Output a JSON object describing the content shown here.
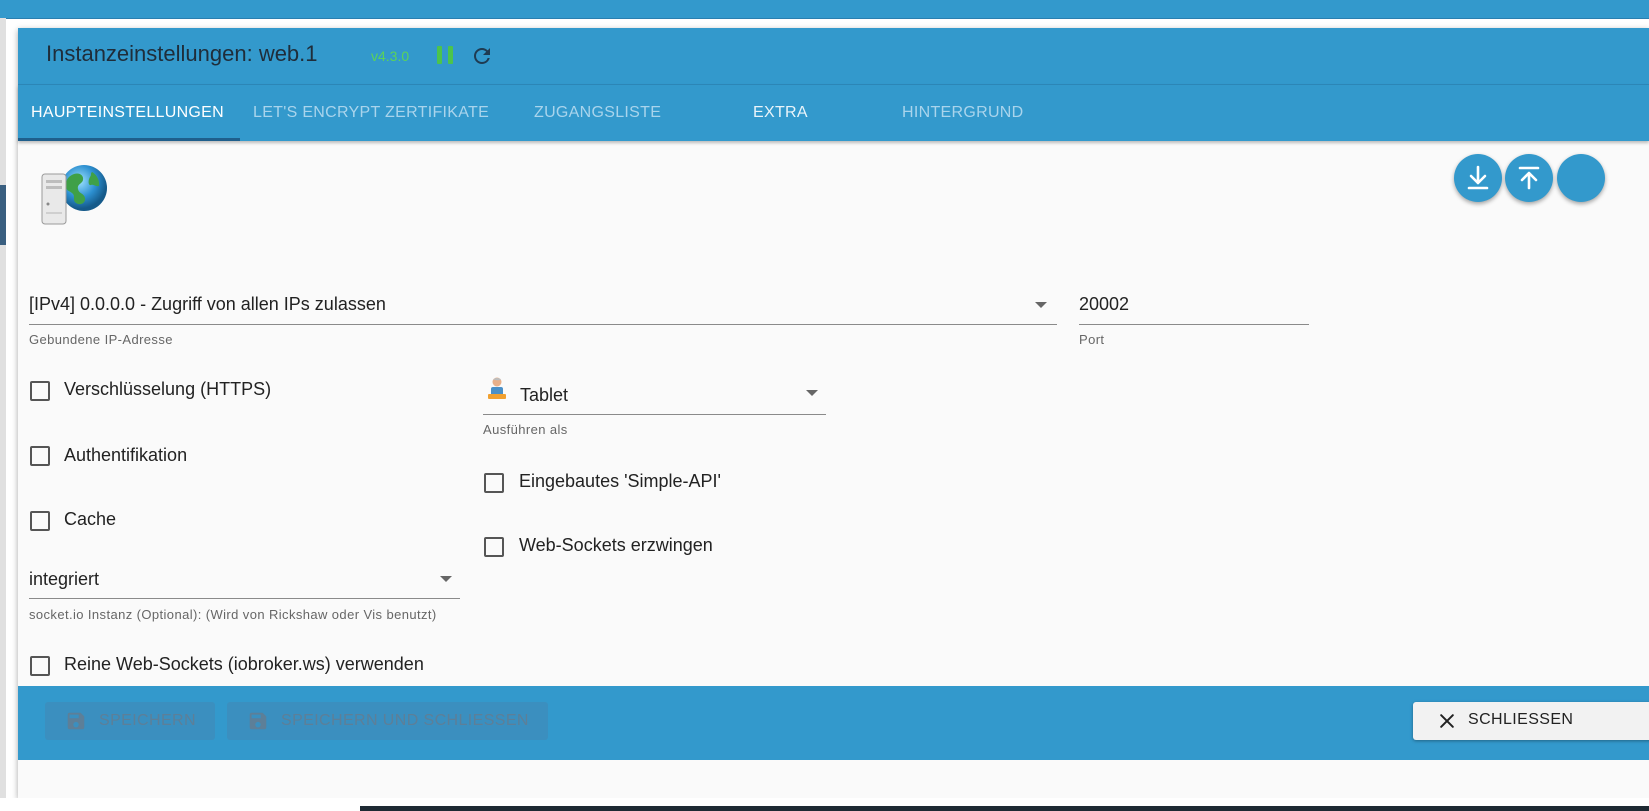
{
  "header": {
    "title": "Instanzeinstellungen: web.1",
    "version": "v4.3.0"
  },
  "tabs": [
    {
      "label": "HAUPTEINSTELLUNGEN",
      "active": true
    },
    {
      "label": "LET'S ENCRYPT ZERTIFIKATE",
      "active": false
    },
    {
      "label": "ZUGANGSLISTE",
      "active": false
    },
    {
      "label": "EXTRA",
      "active": false
    },
    {
      "label": "HINTERGRUND",
      "active": false
    }
  ],
  "form": {
    "bind_ip": {
      "value": "[IPv4] 0.0.0.0 - Zugriff von allen IPs zulassen",
      "helper": "Gebundene IP-Adresse"
    },
    "port": {
      "value": "20002",
      "helper": "Port"
    },
    "run_as": {
      "value": "Tablet",
      "helper": "Ausführen als"
    },
    "socketio": {
      "value": "integriert",
      "helper": "socket.io Instanz (Optional): (Wird von Rickshaw oder Vis benutzt)"
    },
    "checkboxes": {
      "https": {
        "label": "Verschlüsselung (HTTPS)",
        "checked": false
      },
      "auth": {
        "label": "Authentifikation",
        "checked": false
      },
      "cache": {
        "label": "Cache",
        "checked": false
      },
      "simple_api": {
        "label": "Eingebautes 'Simple-API'",
        "checked": false
      },
      "force_ws": {
        "label": "Web-Sockets erzwingen",
        "checked": false
      },
      "pure_ws": {
        "label": "Reine Web-Sockets (iobroker.ws) verwenden",
        "checked": false
      }
    }
  },
  "footer": {
    "save_label": "SPEICHERN",
    "save_close_label": "SPEICHERN UND SCHLIESSEN",
    "close_label": "SCHLIESSEN"
  },
  "colors": {
    "primary": "#3399cc",
    "version_green": "#5ad35a",
    "pause_green": "#4cc44c"
  }
}
